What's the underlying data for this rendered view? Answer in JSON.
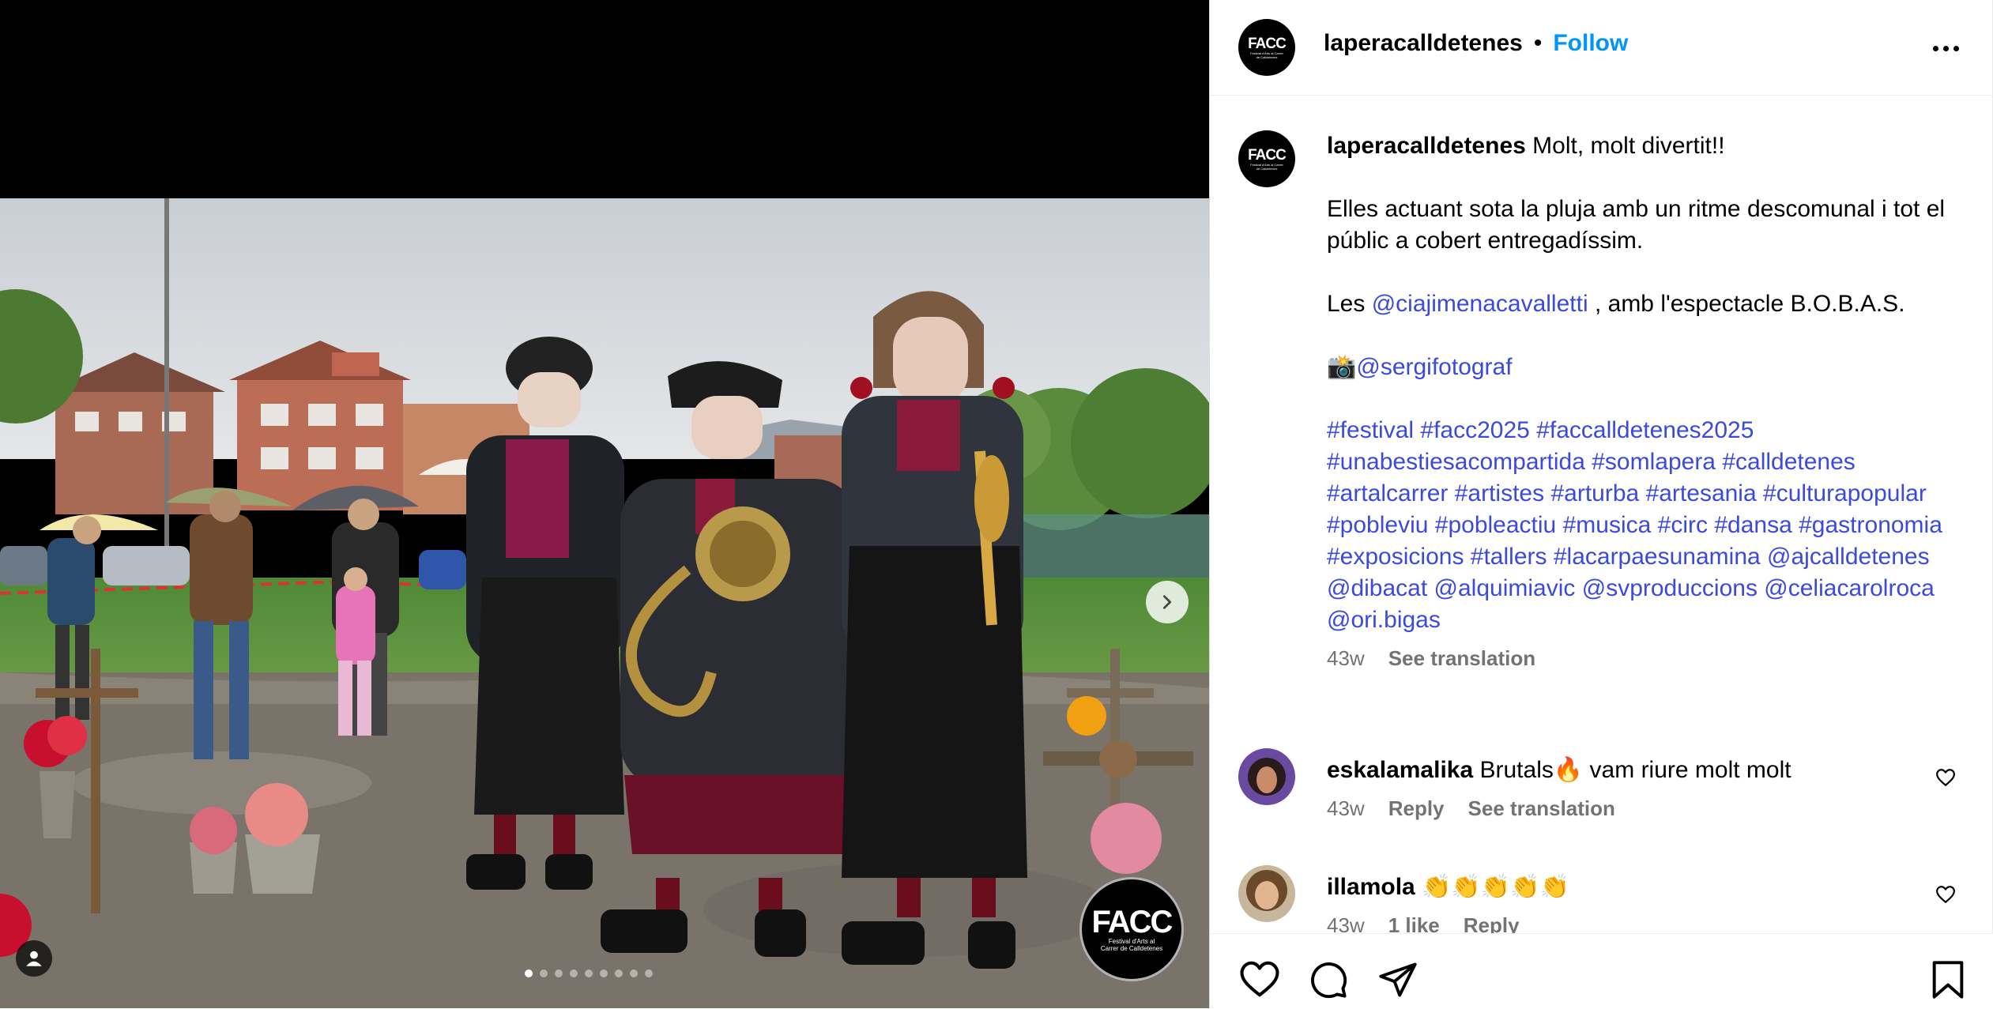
{
  "post": {
    "username": "laperacalldetenes",
    "follow_label": "Follow",
    "separator": "•",
    "avatar_text": "FACC",
    "avatar_subtext": "Festival d'Arts al Carrer de Calldetenes"
  },
  "media": {
    "watermark_text": "FACC",
    "watermark_subtext": "Festival d'Arts al Carrer de Calldetenes",
    "carousel_count": 9,
    "carousel_active": 1,
    "next_icon": "chevron-right-icon",
    "tag_icon": "user-tag-icon"
  },
  "caption": {
    "username": "laperacalldetenes",
    "line1": "Molt, molt divertit!!",
    "para2": "Elles actuant sota la pluja amb un ritme descomunal i tot el públic a cobert entregadíssim.",
    "para3_prefix": "Les ",
    "para3_mention": "@ciajimenacavalletti",
    "para3_suffix": " , amb l'espectacle B.O.B.A.S.",
    "camera_emoji": "📸",
    "photographer": "@sergifotograf",
    "tags": [
      "#festival",
      "#facc2025",
      "#faccalldetenes2025",
      "#unabestiesacompartida",
      "#somlapera",
      "#calldetenes",
      "#artalcarrer",
      "#artistes",
      "#arturba",
      "#artesania",
      "#culturapopular",
      "#pobleviu",
      "#pobleactiu",
      "#musica",
      "#circ",
      "#dansa",
      "#gastronomia",
      "#exposicions",
      "#tallers",
      "#lacarpaesunamina",
      "@ajcalldetenes",
      "@dibacat",
      "@alquimiavic",
      "@svproduccions",
      "@celiacarolroca",
      "@ori.bigas"
    ],
    "time": "43w",
    "see_translation": "See translation"
  },
  "comments": [
    {
      "username": "eskalamalika",
      "text": "Brutals🔥 vam riure molt molt",
      "time": "43w",
      "reply": "Reply",
      "see_translation": "See translation"
    },
    {
      "username": "illamola",
      "text": "👏👏👏👏👏",
      "time": "43w",
      "likes": "1 like",
      "reply": "Reply"
    }
  ],
  "actions": {
    "like_icon": "heart-icon",
    "comment_icon": "comment-icon",
    "share_icon": "share-icon",
    "save_icon": "bookmark-icon"
  },
  "colors": {
    "accent": "#0095f6",
    "link": "#3b49df",
    "muted": "#737373"
  }
}
